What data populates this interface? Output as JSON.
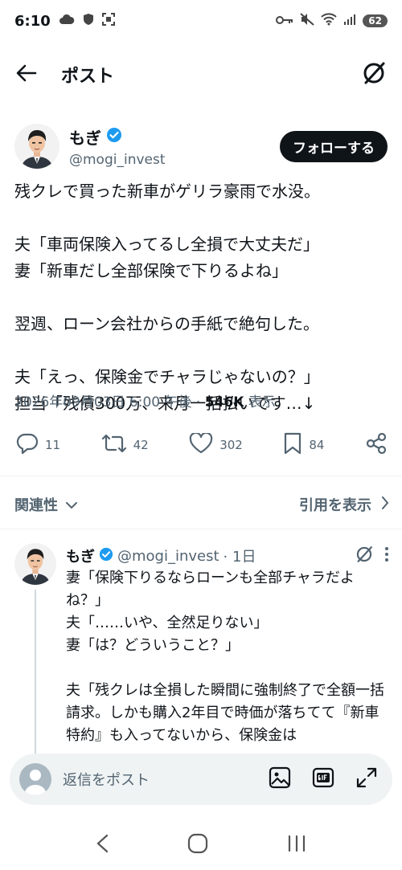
{
  "status_bar": {
    "time": "6:10",
    "battery": "62"
  },
  "header": {
    "title": "ポスト"
  },
  "tweet": {
    "author_name": "もぎ",
    "author_handle": "@mogi_invest",
    "follow_label": "フォローする",
    "text": "残クレで買った新車がゲリラ豪雨で水没。\n\n夫「車両保険入ってるし全損で大丈夫だ」\n妻「新車だし全部保険で下りるよね」\n\n翌週、ローン会社からの手紙で絶句した。\n\n夫「えっ、保険金でチャラじゃないの？」\n担当「残債300万、来月一括払いです…↓",
    "timestamp": "2026年09月03日 6:00 午後",
    "separator": " · ",
    "views_count": "546K",
    "views_label": "表示",
    "replies": "11",
    "reposts": "42",
    "likes": "302",
    "bookmarks": "84"
  },
  "sort": {
    "relevance_label": "関連性",
    "quotes_label": "引用を表示"
  },
  "reply": {
    "author_name": "もぎ",
    "author_handle": "@mogi_invest",
    "time": "· 1日",
    "text": "妻「保険下りるならローンも全部チャラだよね？」\n夫「……いや、全然足りない」\n妻「は？どういうこと？」\n\n夫「残クレは全損した瞬間に強制終了で全額一括請求。しかも購入2年目で時価が落ちてて『新車特約』も入ってないから、保険金は"
  },
  "compose": {
    "placeholder": "返信をポスト"
  },
  "icons": {
    "back": "arrow-left-icon",
    "grok": "grok-icon",
    "verified": "verified-badge-icon",
    "reply": "reply-icon",
    "repost": "repost-icon",
    "like": "heart-icon",
    "bookmark": "bookmark-icon",
    "share": "share-icon",
    "image": "image-icon",
    "gif": "gif-icon",
    "expand": "expand-icon"
  },
  "colors": {
    "verified": "#1d9bf0",
    "text": "#0f1419",
    "secondary": "#536471",
    "follow_bg": "#0f1419"
  }
}
